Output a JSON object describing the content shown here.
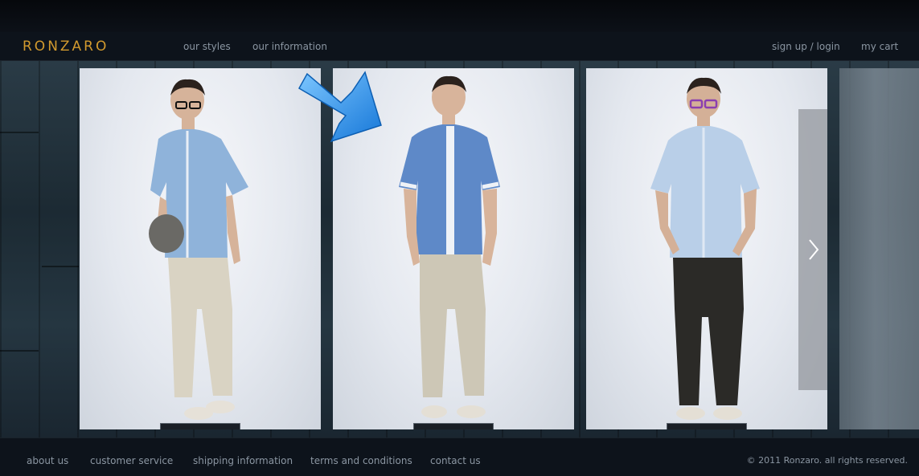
{
  "brand": {
    "logo": "Ronzaro",
    "accent": "#d29a2e"
  },
  "header": {
    "nav_left": [
      {
        "label": "our styles"
      },
      {
        "label": "our information"
      }
    ],
    "nav_right": [
      {
        "label": "sign up / login"
      },
      {
        "label": "my cart"
      }
    ]
  },
  "gallery": {
    "items": [
      {
        "name": "model-1",
        "shirt_color": "#8fb3da",
        "pants_color": "#d9d3c3",
        "accessory": "flat-cap",
        "glasses": "black"
      },
      {
        "name": "model-2",
        "shirt_color": "#5e89c8",
        "pants_color": "#cdc7b6",
        "accessory": "none",
        "glasses": "none"
      },
      {
        "name": "model-3",
        "shirt_color": "#b9cfe8",
        "pants_color": "#2b2a27",
        "accessory": "none",
        "glasses": "purple"
      }
    ],
    "next_icon": "chevron-right-icon",
    "pointer_icon": "blue-arrow-icon"
  },
  "footer": {
    "links": [
      {
        "label": "about us"
      },
      {
        "label": "customer service"
      },
      {
        "label": "shipping information"
      },
      {
        "label": "terms and conditions"
      },
      {
        "label": "contact us"
      }
    ],
    "copyright": "© 2011 Ronzaro. all rights reserved."
  }
}
